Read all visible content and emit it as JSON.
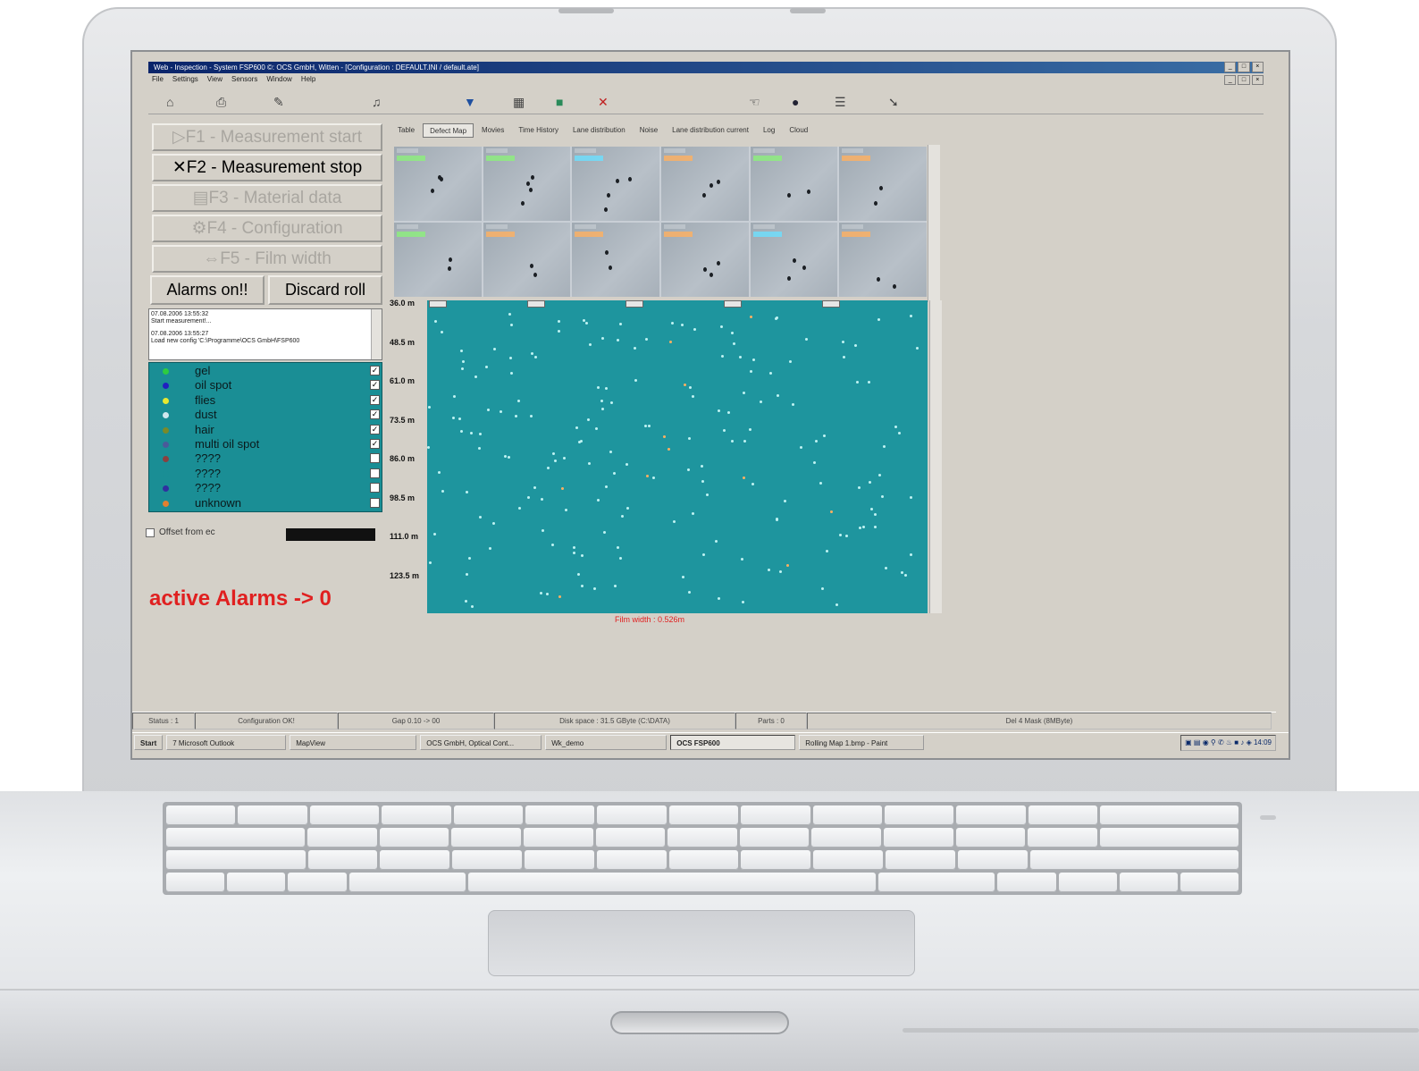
{
  "window": {
    "title": "Web - Inspection - System FSP600 ©: OCS GmbH, Witten - [Configuration : DEFAULT.INI / default.ate]",
    "controls": [
      "_",
      "□",
      "×"
    ]
  },
  "menu": [
    "File",
    "Settings",
    "View",
    "Sensors",
    "Window",
    "Help"
  ],
  "toolbar_icons": [
    "home-icon",
    "print-icon",
    "pen-icon",
    "bell-icon",
    "filter-icon",
    "grid-icon",
    "save-icon",
    "tools-icon",
    "hand-icon",
    "shield-icon",
    "list-icon"
  ],
  "function_buttons": [
    {
      "label": "F1 - Measurement start",
      "active": false
    },
    {
      "label": "F2 - Measurement stop",
      "active": true
    },
    {
      "label": "F3 - Material data",
      "active": false
    },
    {
      "label": "F4 - Configuration",
      "active": false
    },
    {
      "label": "F5 - Film width",
      "active": false
    }
  ],
  "alarms_button": "Alarms on!!",
  "discard_button": "Discard roll",
  "log": [
    "07.08.2006 13:55:32",
    "Start measurement!...",
    "07.08.2006 13:55:27",
    "Load new config 'C:\\Programme\\OCS GmbH\\FSP600"
  ],
  "defect_classes": [
    {
      "label": "gel",
      "color": "#2ecc40",
      "checked": true
    },
    {
      "label": "oil spot",
      "color": "#2020c0",
      "checked": true
    },
    {
      "label": "flies",
      "color": "#e8e830",
      "checked": true
    },
    {
      "label": "dust",
      "color": "#cfe8ee",
      "checked": true
    },
    {
      "label": "hair",
      "color": "#7a8a2a",
      "checked": true
    },
    {
      "label": "multi oil spot",
      "color": "#4a5a9a",
      "checked": true
    },
    {
      "label": "????",
      "color": "#8a4040",
      "checked": false
    },
    {
      "label": "????",
      "color": "#1a8e95",
      "checked": false
    },
    {
      "label": "????",
      "color": "#3030a0",
      "checked": false
    },
    {
      "label": "unknown",
      "color": "#e08030",
      "checked": false
    }
  ],
  "offset_label": "Offset from ec",
  "active_alarms": "active Alarms -> 0",
  "tabs": [
    "Table",
    "Defect Map",
    "Movies",
    "Time History",
    "Lane distribution",
    "Noise",
    "Lane distribution current",
    "Log",
    "Cloud"
  ],
  "selected_tab": "Defect Map",
  "row_labels": [
    "36.0 m",
    "48.5 m",
    "61.0 m",
    "73.5 m",
    "86.0 m",
    "98.5 m",
    "111.0 m",
    "123.5 m"
  ],
  "film_width": "Film width : 0.526m",
  "status_bar": [
    "Status : 1",
    "Configuration OK!",
    "Gap 0.10 -> 00",
    "Disk space : 31.5 GByte (C:\\DATA)",
    "Parts : 0",
    "Del 4 Mask (8MByte)"
  ],
  "taskbar": {
    "start": "Start",
    "tasks": [
      "7 Microsoft Outlook",
      "MapView",
      "OCS GmbH, Optical Cont...",
      "Wk_demo",
      "OCS FSP600",
      "Rolling Map 1.bmp - Paint"
    ],
    "selected_task": "OCS FSP600",
    "clock": "14:09"
  }
}
